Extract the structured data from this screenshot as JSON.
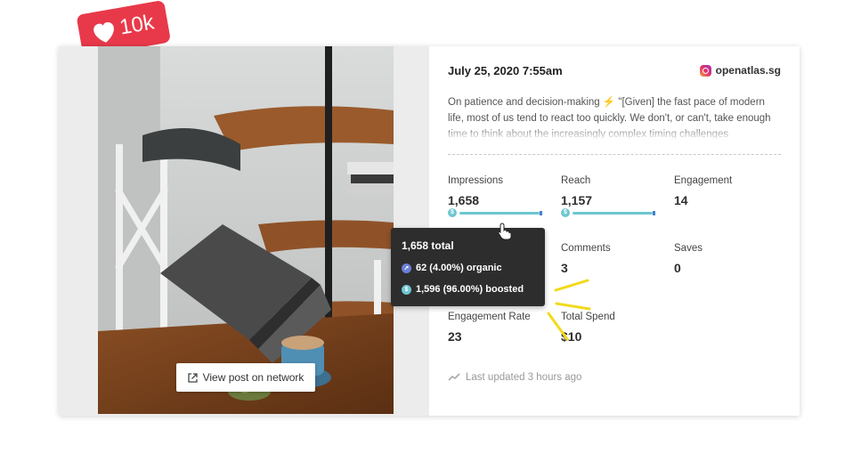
{
  "badge": {
    "count": "10k",
    "color": "#e8394a"
  },
  "media": {
    "view_button_label": "View post on network"
  },
  "post": {
    "date": "July 25, 2020 7:55am",
    "account": "openatlas.sg",
    "caption": "On patience and decision-making ⚡ \"[Given] the fast pace of modern life, most of us tend to react too quickly. We don't, or can't, take enough time to think about the increasingly complex timing challenges"
  },
  "metrics": {
    "impressions": {
      "label": "Impressions",
      "value": "1,658"
    },
    "reach": {
      "label": "Reach",
      "value": "1,157"
    },
    "engagement": {
      "label": "Engagement",
      "value": "14"
    },
    "comments": {
      "label": "Comments",
      "value": "3"
    },
    "saves": {
      "label": "Saves",
      "value": "0"
    },
    "engagement_rate": {
      "label": "Engagement Rate",
      "value": "23"
    },
    "total_spend": {
      "label": "Total Spend",
      "value": "$10"
    }
  },
  "tooltip": {
    "total": "1,658 total",
    "organic": "62 (4.00%) organic",
    "boosted": "1,596 (96.00%) boosted",
    "organic_share": 0.04,
    "boosted_share": 0.96
  },
  "footer": {
    "updated": "Last updated 3 hours ago"
  },
  "colors": {
    "accent": "#6dc7d1",
    "organic": "#6b7fd7",
    "boosted_tip": "#4a7fd4"
  }
}
